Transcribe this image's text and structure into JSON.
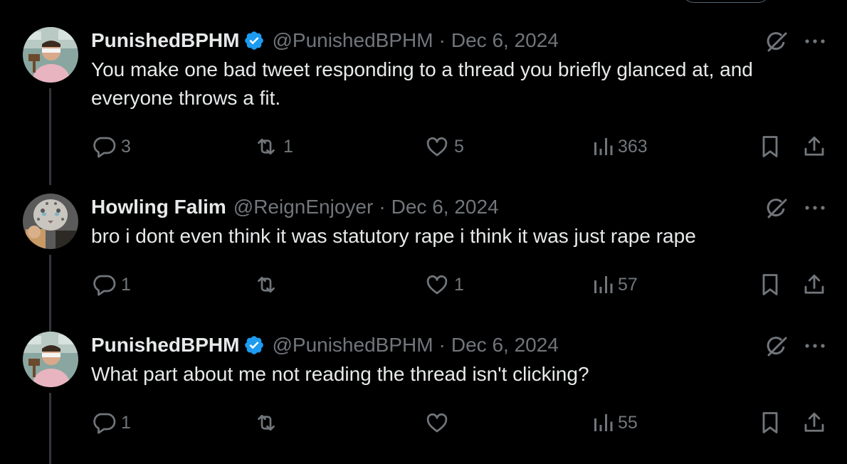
{
  "tweets": [
    {
      "name": "PunishedBPHM",
      "verified": true,
      "handle": "@PunishedBPHM",
      "separator": "·",
      "date": "Dec 6, 2024",
      "text": "You make one bad tweet responding to a thread you briefly glanced at, and everyone throws a fit.",
      "replies": "3",
      "reposts": "1",
      "likes": "5",
      "views": "363"
    },
    {
      "name": "Howling Falim",
      "verified": false,
      "handle": "@ReignEnjoyer",
      "separator": "·",
      "date": "Dec 6, 2024",
      "text": "bro i dont even think it was statutory rape i think it was just rape rape",
      "replies": "1",
      "reposts": "",
      "likes": "1",
      "views": "57"
    },
    {
      "name": "PunishedBPHM",
      "verified": true,
      "handle": "@PunishedBPHM",
      "separator": "·",
      "date": "Dec 6, 2024",
      "text": "What part about me not reading the thread isn't clicking?",
      "replies": "1",
      "reposts": "",
      "likes": "",
      "views": "55"
    }
  ],
  "colors": {
    "background": "#000000",
    "text": "#e7e9ea",
    "muted": "#71767b",
    "verified_blue": "#1d9bf0",
    "thread_line": "#333639"
  },
  "icons": [
    "verified-badge-icon",
    "grok-icon",
    "more-icon",
    "reply-icon",
    "repost-icon",
    "like-icon",
    "views-icon",
    "bookmark-icon",
    "share-icon"
  ]
}
